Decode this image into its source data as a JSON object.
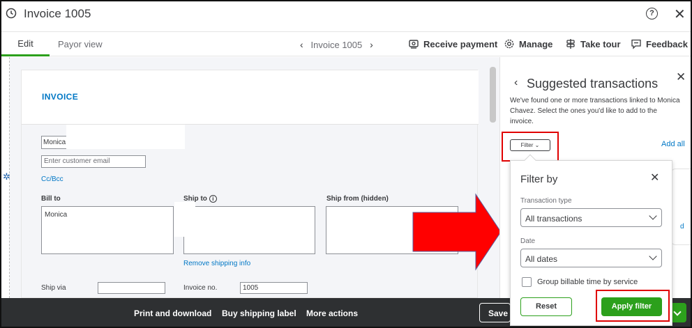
{
  "window": {
    "title": "Invoice 1005",
    "help_label": "?",
    "close_label": "✕"
  },
  "nav": {
    "tabs": [
      {
        "label": "Edit",
        "active": true
      },
      {
        "label": "Payor view",
        "active": false
      }
    ],
    "invoice_nav_label": "Invoice 1005",
    "prev_glyph": "‹",
    "next_glyph": "›",
    "actions": [
      {
        "label": "Receive payment",
        "icon": "receive-payment-icon"
      },
      {
        "label": "Manage",
        "icon": "gear-icon"
      },
      {
        "label": "Take tour",
        "icon": "signpost-icon"
      },
      {
        "label": "Feedback",
        "icon": "feedback-icon"
      }
    ]
  },
  "invoice": {
    "heading": "INVOICE",
    "customer_value": "Monica",
    "email_placeholder": "Enter customer email",
    "ccbcc_label": "Cc/Bcc",
    "bill_to_label": "Bill to",
    "bill_to_value": "Monica",
    "ship_to_label": "Ship to",
    "ship_from_label": "Ship from (hidden)",
    "remove_shipping_label": "Remove shipping info",
    "ship_via_label": "Ship via",
    "invoice_no_label": "Invoice no.",
    "invoice_no_value": "1005"
  },
  "bottom_bar": {
    "print_label": "Print and download",
    "shipping_label": "Buy shipping label",
    "more_label": "More actions",
    "save_label": "Save"
  },
  "panel": {
    "back_glyph": "‹",
    "title": "Suggested transactions",
    "close_glyph": "✕",
    "description": "We've found one or more transactions linked to Monica Chavez. Select the ones you'd like to add to the invoice.",
    "filter_label": "Filter",
    "add_all_label": "Add all",
    "card_link": "d"
  },
  "filter_popover": {
    "title": "Filter by",
    "close_glyph": "✕",
    "transaction_type_label": "Transaction type",
    "transaction_type_value": "All transactions",
    "date_label": "Date",
    "date_value": "All dates",
    "group_label": "Group billable time by service",
    "group_checked": false,
    "reset_label": "Reset",
    "apply_label": "Apply filter"
  },
  "colors": {
    "accent_green": "#2ca01c",
    "link_blue": "#0077c5",
    "highlight_red": "#e00000",
    "bottom_bar": "#2e3032"
  }
}
